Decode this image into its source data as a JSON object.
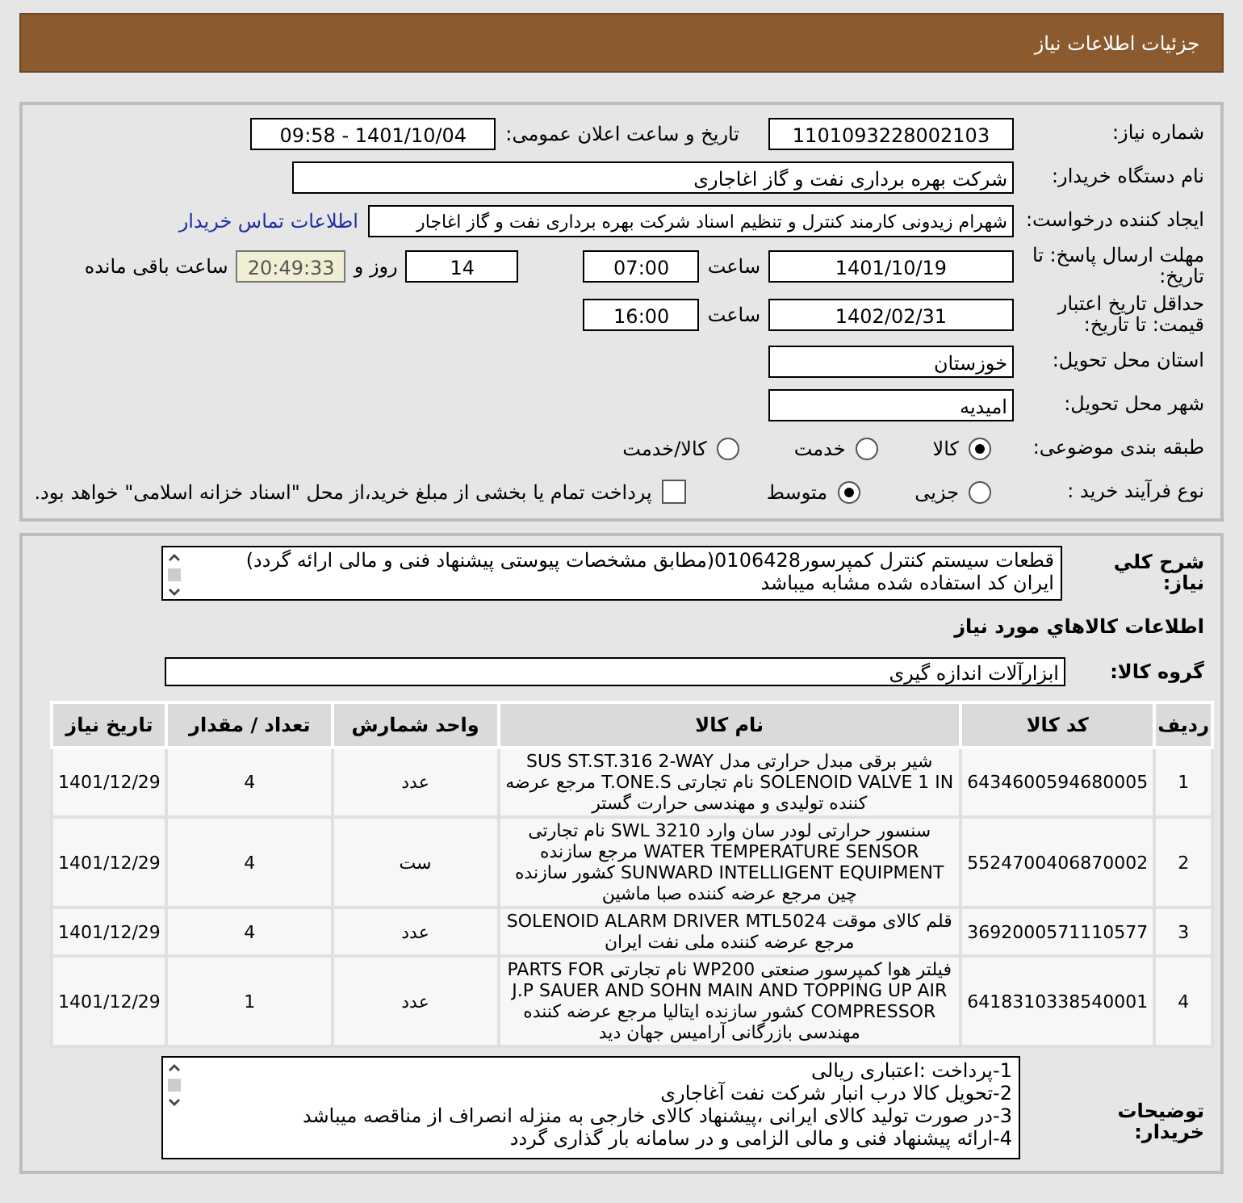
{
  "header": {
    "title": "جزئیات اطلاعات نیاز"
  },
  "form": {
    "need_number": {
      "label": "شماره نیاز:",
      "value": "1101093228002103"
    },
    "announce": {
      "label": "تاریخ و ساعت اعلان عمومی:",
      "value": "1401/10/04 - 09:58"
    },
    "buyer_org": {
      "label": "نام دستگاه خریدار:",
      "value": "شرکت بهره برداری نفت و گاز اغاجاری"
    },
    "requester": {
      "label": "ایجاد کننده درخواست:",
      "value": "شهرام زیدونی کارمند کنترل و تنظیم اسناد شرکت بهره برداری نفت و گاز اغاجار",
      "link": "اطلاعات تماس خریدار"
    },
    "deadline": {
      "label": "مهلت ارسال پاسخ: تا تاریخ:",
      "date": "1401/10/19",
      "time_label": "ساعت",
      "time": "07:00",
      "days": "14",
      "days_label": "روز و",
      "remaining": "20:49:33",
      "remaining_label": "ساعت باقی مانده"
    },
    "validity": {
      "label": "حداقل تاریخ اعتبار قیمت: تا تاریخ:",
      "date": "1402/02/31",
      "time_label": "ساعت",
      "time": "16:00"
    },
    "province": {
      "label": "استان محل تحویل:",
      "value": "خوزستان"
    },
    "city": {
      "label": "شهر محل تحویل:",
      "value": "امیدیه"
    },
    "category": {
      "label": "طبقه بندی موضوعی:",
      "options": [
        {
          "label": "کالا",
          "selected": true
        },
        {
          "label": "خدمت",
          "selected": false
        },
        {
          "label": "کالا/خدمت",
          "selected": false
        }
      ]
    },
    "process": {
      "label": "نوع فرآیند خرید :",
      "options": [
        {
          "label": "جزیی",
          "selected": false
        },
        {
          "label": "متوسط",
          "selected": true
        }
      ],
      "checkbox": {
        "label": "پرداخت تمام یا بخشی از مبلغ خرید،از محل \"اسناد خزانه اسلامی\" خواهد بود.",
        "checked": false
      }
    }
  },
  "details": {
    "summary": {
      "label": "شرح کلي نياز:",
      "lines": [
        "قطعات سیستم کنترل کمپرسور0106428(مطابق مشخصات پیوستی پیشنهاد فنی و مالی ارائه گردد)",
        "ایران کد استفاده شده مشابه میباشد"
      ]
    },
    "goods_heading": "اطلاعات کالاهاي مورد نياز",
    "goods_group": {
      "label": "گروه کالا:",
      "value": "ابزارآلات اندازه گیری"
    },
    "table": {
      "columns": [
        "ردیف",
        "کد کالا",
        "نام کالا",
        "واحد شمارش",
        "تعداد / مقدار",
        "تاریخ نیاز"
      ],
      "rows": [
        [
          "1",
          "6434600594680005",
          "شیر برقی مبدل حرارتی مدل SUS ST.ST.316 2-WAY SOLENOID VALVE 1 IN نام تجارتی T.ONE.S مرجع عرضه کننده تولیدی و مهندسی حرارت گستر",
          "عدد",
          "4",
          "1401/12/29"
        ],
        [
          "2",
          "5524700406870002",
          "سنسور حرارتی لودر سان وارد SWL 3210 نام تجارتی WATER TEMPERATURE SENSOR مرجع سازنده SUNWARD INTELLIGENT EQUIPMENT کشور سازنده چین مرجع عرضه کننده صبا ماشین",
          "ست",
          "4",
          "1401/12/29"
        ],
        [
          "3",
          "3692000571110577",
          "قلم کالای موقت SOLENOID ALARM DRIVER MTL5024 مرجع عرضه کننده ملی نفت ایران",
          "عدد",
          "4",
          "1401/12/29"
        ],
        [
          "4",
          "6418310338540001",
          "فیلتر هوا کمپرسور صنعتی WP200 نام تجارتی PARTS FOR J.P SAUER AND SOHN MAIN AND TOPPING UP AIR COMPRESSOR کشور سازنده ایتالیا مرجع عرضه کننده مهندسی بازرگانی آرامیس جهان دید",
          "عدد",
          "1",
          "1401/12/29"
        ]
      ]
    },
    "buyer_notes": {
      "label": "توضیحات خریدار:",
      "lines": [
        "1-پرداخت :اعتباری ریالی",
        "2-تحویل کالا درب انبار شرکت نفت آغاجاری",
        "3-در صورت تولید کالای ایرانی ،پیشنهاد کالای خارجی به منزله انصراف از مناقصه میباشد",
        "4-ارائه پیشنهاد فنی و مالی الزامی و در سامانه بار گذاری گردد"
      ]
    }
  }
}
